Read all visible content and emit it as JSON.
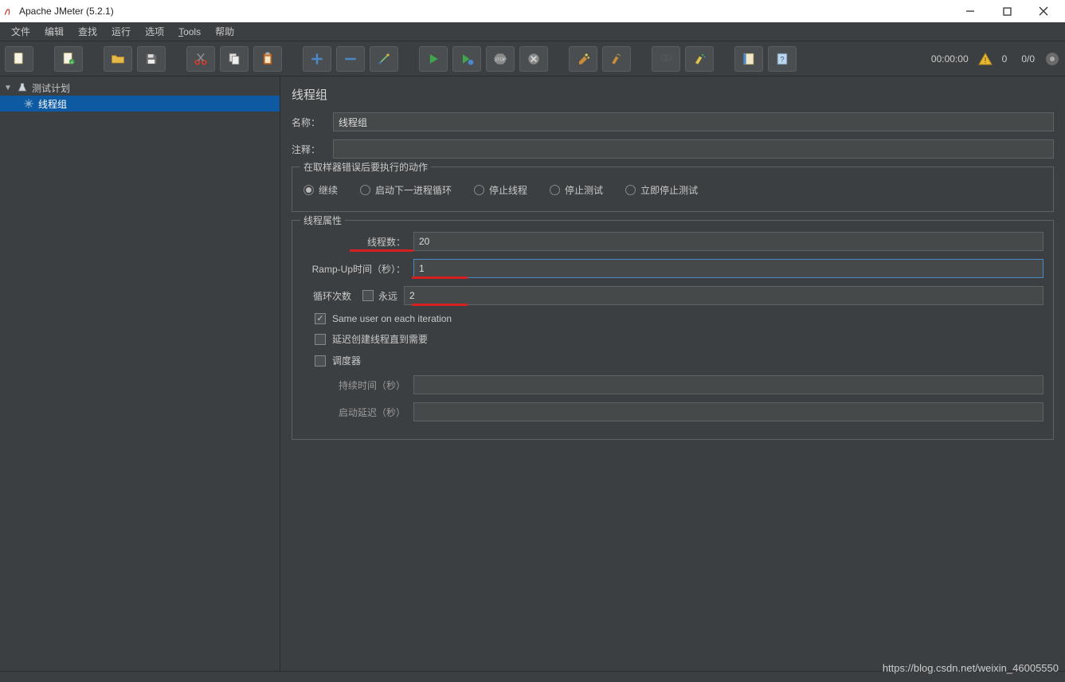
{
  "window": {
    "title": "Apache JMeter (5.2.1)"
  },
  "menu": {
    "file": "文件",
    "edit": "编辑",
    "search": "查找",
    "run": "运行",
    "options": "选项",
    "tools": "Tools",
    "help": "帮助"
  },
  "toolbar_stats": {
    "elapsed": "00:00:00",
    "warn_count": "0",
    "active": "0/0"
  },
  "tree": {
    "root": "测试计划",
    "thread_group": "线程组"
  },
  "panel": {
    "title": "线程组",
    "name_label": "名称：",
    "name_value": "线程组",
    "comment_label": "注释：",
    "comment_value": "",
    "on_error": {
      "legend": "在取样器错误后要执行的动作",
      "continue": "继续",
      "start_next": "启动下一进程循环",
      "stop_thread": "停止线程",
      "stop_test": "停止测试",
      "stop_now": "立即停止测试",
      "selected": "continue"
    },
    "thread_props": {
      "legend": "线程属性",
      "threads_label": "线程数：",
      "threads_value": "20",
      "rampup_label": "Ramp-Up时间（秒）：",
      "rampup_value": "1",
      "loop_label": "循环次数",
      "forever_label": "永远",
      "loop_value": "2",
      "same_user_label": "Same user on each iteration",
      "delay_label": "延迟创建线程直到需要",
      "scheduler_label": "调度器",
      "duration_label": "持续时间（秒）",
      "duration_value": "",
      "startup_delay_label": "启动延迟（秒）",
      "startup_delay_value": ""
    }
  },
  "watermark": "https://blog.csdn.net/weixin_46005550"
}
